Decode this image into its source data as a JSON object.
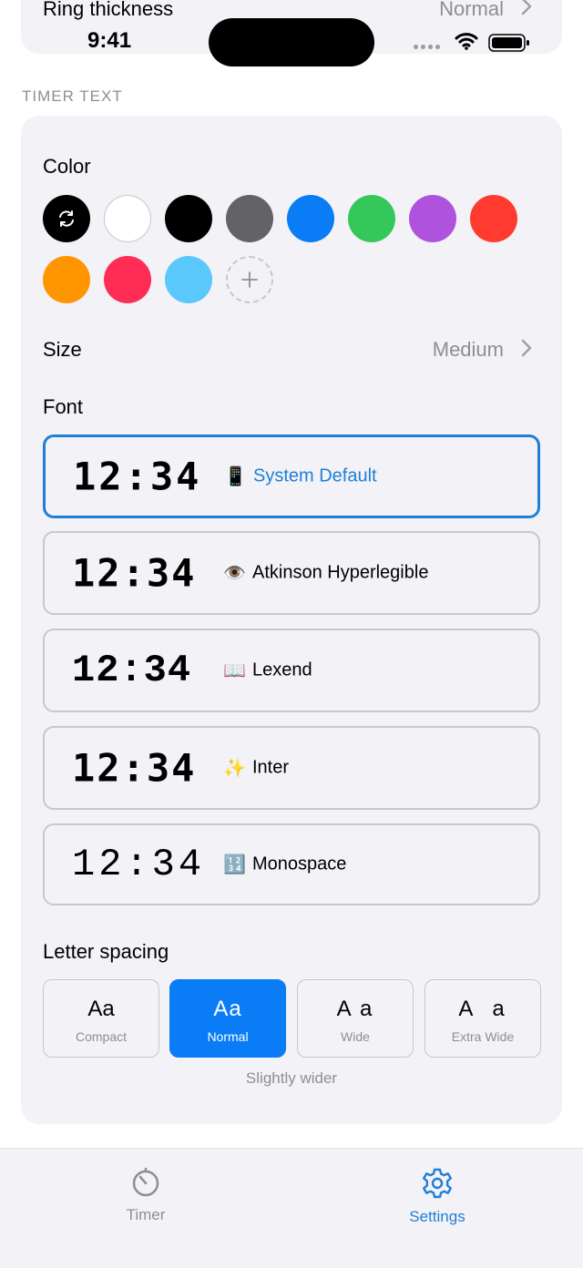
{
  "status_bar": {
    "time": "9:41"
  },
  "prev_row": {
    "label": "Ring thickness",
    "value": "Normal"
  },
  "section": {
    "header": "TIMER TEXT"
  },
  "color": {
    "label": "Color",
    "swatches": [
      "#000000",
      "#ffffff",
      "#000000",
      "#636366",
      "#0a7cf6",
      "#34c759",
      "#af52de",
      "#ff3b30",
      "#ff9500",
      "#ff2d55",
      "#5ac8fa"
    ]
  },
  "size": {
    "label": "Size",
    "value": "Medium"
  },
  "font": {
    "label": "Font",
    "options": [
      {
        "sample": "12:34",
        "emoji": "📱",
        "name": "System Default",
        "selected": true
      },
      {
        "sample": "12:34",
        "emoji": "👁️",
        "name": "Atkinson Hyperlegible",
        "selected": false
      },
      {
        "sample": "12:34",
        "emoji": "📖",
        "name": "Lexend",
        "selected": false
      },
      {
        "sample": "12:34",
        "emoji": "✨",
        "name": "Inter",
        "selected": false
      },
      {
        "sample": "12:34",
        "emoji": "🔢",
        "name": "Monospace",
        "selected": false
      }
    ]
  },
  "letter_spacing": {
    "label": "Letter spacing",
    "options": [
      {
        "sample": "Aa",
        "caption": "Compact",
        "selected": false
      },
      {
        "sample": "Aa",
        "caption": "Normal",
        "selected": true
      },
      {
        "sample": "A a",
        "caption": "Wide",
        "selected": false
      },
      {
        "sample": "A  a",
        "caption": "Extra Wide",
        "selected": false
      }
    ],
    "hint": "Slightly wider"
  },
  "tabbar": {
    "tabs": [
      {
        "label": "Timer",
        "active": false
      },
      {
        "label": "Settings",
        "active": true
      }
    ]
  },
  "colors": {
    "accent": "#1f7fd6",
    "selected_fill": "#0a7cf6",
    "card_bg": "#f2f2f7",
    "secondary_text": "#8e8e93"
  }
}
